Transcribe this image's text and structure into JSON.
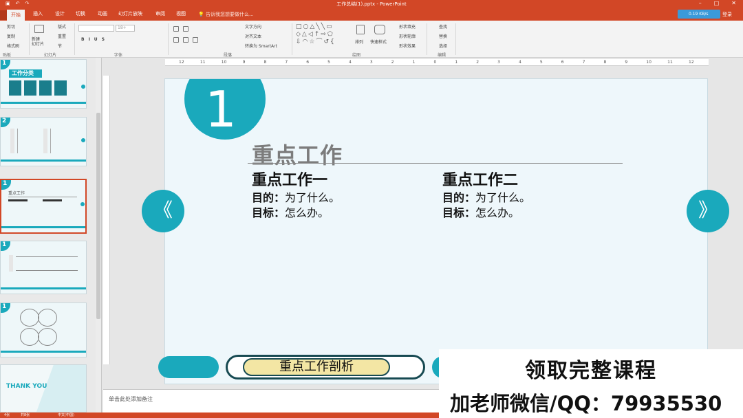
{
  "window": {
    "title": "工作总结(1).pptx - PowerPoint",
    "login": "登录",
    "network": "0.19 KB/s"
  },
  "tabs": [
    {
      "label": "开始",
      "active": true
    },
    {
      "label": "插入"
    },
    {
      "label": "设计"
    },
    {
      "label": "切换"
    },
    {
      "label": "动画"
    },
    {
      "label": "幻灯片放映"
    },
    {
      "label": "审阅"
    },
    {
      "label": "视图"
    }
  ],
  "tell_me": "告诉我您想要做什么...",
  "ribbon": {
    "groups": {
      "clipboard": "贴板",
      "slides": "幻灯片",
      "font": "字体",
      "paragraph": "段落",
      "drawing": "绘图",
      "editing": "编辑"
    },
    "clipboard": {
      "cut": "剪切",
      "copy": "复制",
      "format": "格式刷"
    },
    "slides": {
      "new": "新建\n幻灯片",
      "layout": "版式",
      "reset": "重置",
      "section": "节"
    },
    "font_size": "18+",
    "paragraph": {
      "text_dir": "文字方向",
      "align_text": "对齐文本",
      "smartart": "转换为 SmartArt"
    },
    "drawing": {
      "arrange": "排列",
      "quick_styles": "快速样式",
      "fill": "形状填充",
      "outline": "形状轮廓",
      "effects": "形状效果"
    },
    "editing": {
      "find": "查找",
      "replace": "替换",
      "select": "选择"
    }
  },
  "thumbnails": [
    {
      "num": "1",
      "title": "工作分类"
    },
    {
      "num": "2",
      "title": ""
    },
    {
      "num": "1",
      "title": "重点工作",
      "selected": true
    },
    {
      "num": "1",
      "title": ""
    },
    {
      "num": "1",
      "title": ""
    },
    {
      "num": "",
      "title": "THANK YOU"
    }
  ],
  "ruler_ticks": [
    "12",
    "11",
    "10",
    "9",
    "8",
    "7",
    "6",
    "5",
    "4",
    "3",
    "2",
    "1",
    "0",
    "1",
    "2",
    "3",
    "4",
    "5",
    "6",
    "7",
    "8",
    "9",
    "10",
    "11",
    "12"
  ],
  "slide": {
    "number": "1",
    "title": "重点工作",
    "col1": {
      "heading": "重点工作一",
      "line1_label": "目的：",
      "line1_text": "为了什么。",
      "line2_label": "目标：",
      "line2_text": "怎么办。"
    },
    "col2": {
      "heading": "重点工作二",
      "line1_label": "目的：",
      "line1_text": "为了什么。",
      "line2_label": "目标：",
      "line2_text": "怎么办。"
    },
    "prev_arrow": "《",
    "next_arrow": "》",
    "nav_label": "重点工作剖析"
  },
  "notes_placeholder": "单击此处添加备注",
  "status": {
    "slide": "4张",
    "of": "共8张",
    "lang": "中文(中国)"
  },
  "ad": {
    "line1": "领取完整课程",
    "line2": "加老师微信/QQ：79935530"
  },
  "colors": {
    "accent": "#1aa9bc",
    "office": "#d24726",
    "nav_fill": "#f3e6a4"
  }
}
